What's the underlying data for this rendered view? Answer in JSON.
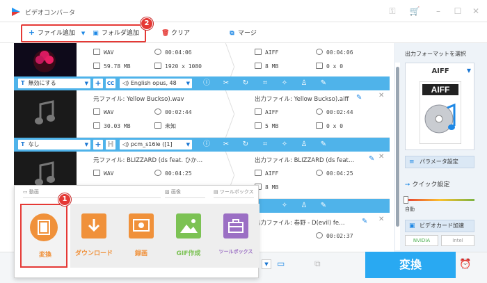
{
  "app": {
    "title": "ビデオコンバータ",
    "accent": "#29a9f2",
    "highlight": "#e53935"
  },
  "toolbar": {
    "add_file": "ファイル追加",
    "add_folder": "フォルダ追加",
    "clear": "クリア",
    "merge": "マージ",
    "badge_folder": "2"
  },
  "rows": [
    {
      "src_format": "WAV",
      "src_duration": "00:04:06",
      "src_size": "59.78 MB",
      "src_resolution": "1920 x 1080",
      "dst_format": "AIFF",
      "dst_duration": "00:04:06",
      "dst_size": "8 MB",
      "dst_resolution": "0 x 0"
    },
    {
      "src_name": "元ファイル: Yellow Buckso).wav",
      "dst_name": "出力ファイル: Yellow Buckso).aiff",
      "src_format": "WAV",
      "src_duration": "00:02:44",
      "src_size": "30.03 MB",
      "src_resolution": "未知",
      "dst_format": "AIFF",
      "dst_duration": "00:02:44",
      "dst_size": "5 MB",
      "dst_resolution": "0 x 0"
    },
    {
      "src_name": "元ファイル: BLIZZARD (ds feat. ひか…",
      "dst_name": "出力ファイル: BLIZZARD (ds feat…",
      "src_format": "WAV",
      "src_duration": "00:04:25",
      "dst_format": "AIFF",
      "dst_duration": "00:04:25",
      "dst_size": "8 MB"
    },
    {
      "dst_name": "出力ファイル: 春野 - D(evil) fe…",
      "dst_duration": "00:02:37"
    }
  ],
  "strips": [
    {
      "subtitle": "無効にする",
      "audio": "English opus, 48"
    },
    {
      "subtitle": "なし",
      "audio": "pcm_s16le ([1]"
    }
  ],
  "panel": {
    "title": "出力フォーマットを選択",
    "format": "AIFF",
    "format_badge": "AIFF",
    "params": "パラメータ設定",
    "quick": "クイック設定",
    "auto": "自動",
    "gpu": "ビデオカード加速",
    "nvidia": "NVIDIA",
    "intel": "Intel"
  },
  "popup": {
    "sec_video": "動画",
    "sec_image": "画像",
    "sec_toolbox": "ツールボックス",
    "badge_convert": "1",
    "tiles": [
      {
        "label": "変換",
        "color": "#f0913a"
      },
      {
        "label": "ダウンロード",
        "color": "#f0913a"
      },
      {
        "label": "録画",
        "color": "#f0913a"
      },
      {
        "label": "GIF作成",
        "color": "#7cc254"
      },
      {
        "label": "ツールボックス",
        "color": "#9b6fc4"
      }
    ]
  },
  "bottom": {
    "convert": "変換"
  }
}
